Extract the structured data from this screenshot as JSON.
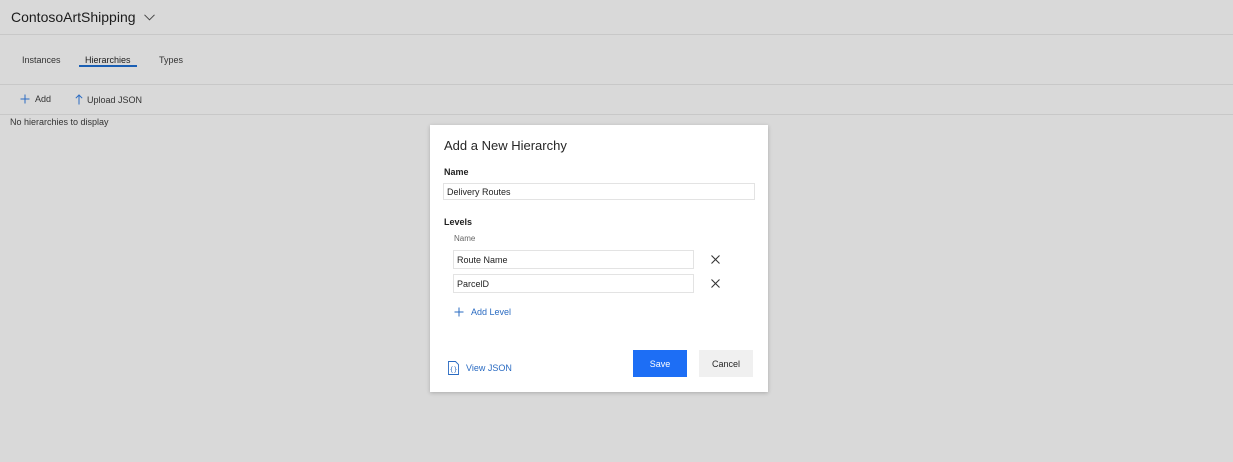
{
  "header": {
    "environment_name": "ContosoArtShipping",
    "dropdown_icon": "chevron-down-icon"
  },
  "tabs": [
    {
      "label": "Instances",
      "active": false
    },
    {
      "label": "Hierarchies",
      "active": true
    },
    {
      "label": "Types",
      "active": false
    }
  ],
  "toolbar": {
    "add_label": "Add",
    "add_icon": "plus-icon",
    "upload_label": "Upload JSON",
    "upload_icon": "upload-arrow-icon"
  },
  "main": {
    "empty_message": "No hierarchies to display"
  },
  "dialog": {
    "title": "Add a New Hierarchy",
    "name_label": "Name",
    "name_value": "Delivery Routes",
    "levels_label": "Levels",
    "levels_column_label": "Name",
    "levels": [
      {
        "value": "Route Name",
        "remove_icon": "close-icon"
      },
      {
        "value": "ParcelD",
        "remove_icon": "close-icon"
      }
    ],
    "add_level_label": "Add Level",
    "add_level_icon": "plus-icon",
    "view_json_label": "View JSON",
    "view_json_icon": "json-braces-icon",
    "save_label": "Save",
    "cancel_label": "Cancel"
  },
  "colors": {
    "accent": "#1D6EF5",
    "link": "#2A6BC2",
    "tab_underline": "#1A5FB4",
    "background": "#D9D9D9"
  }
}
